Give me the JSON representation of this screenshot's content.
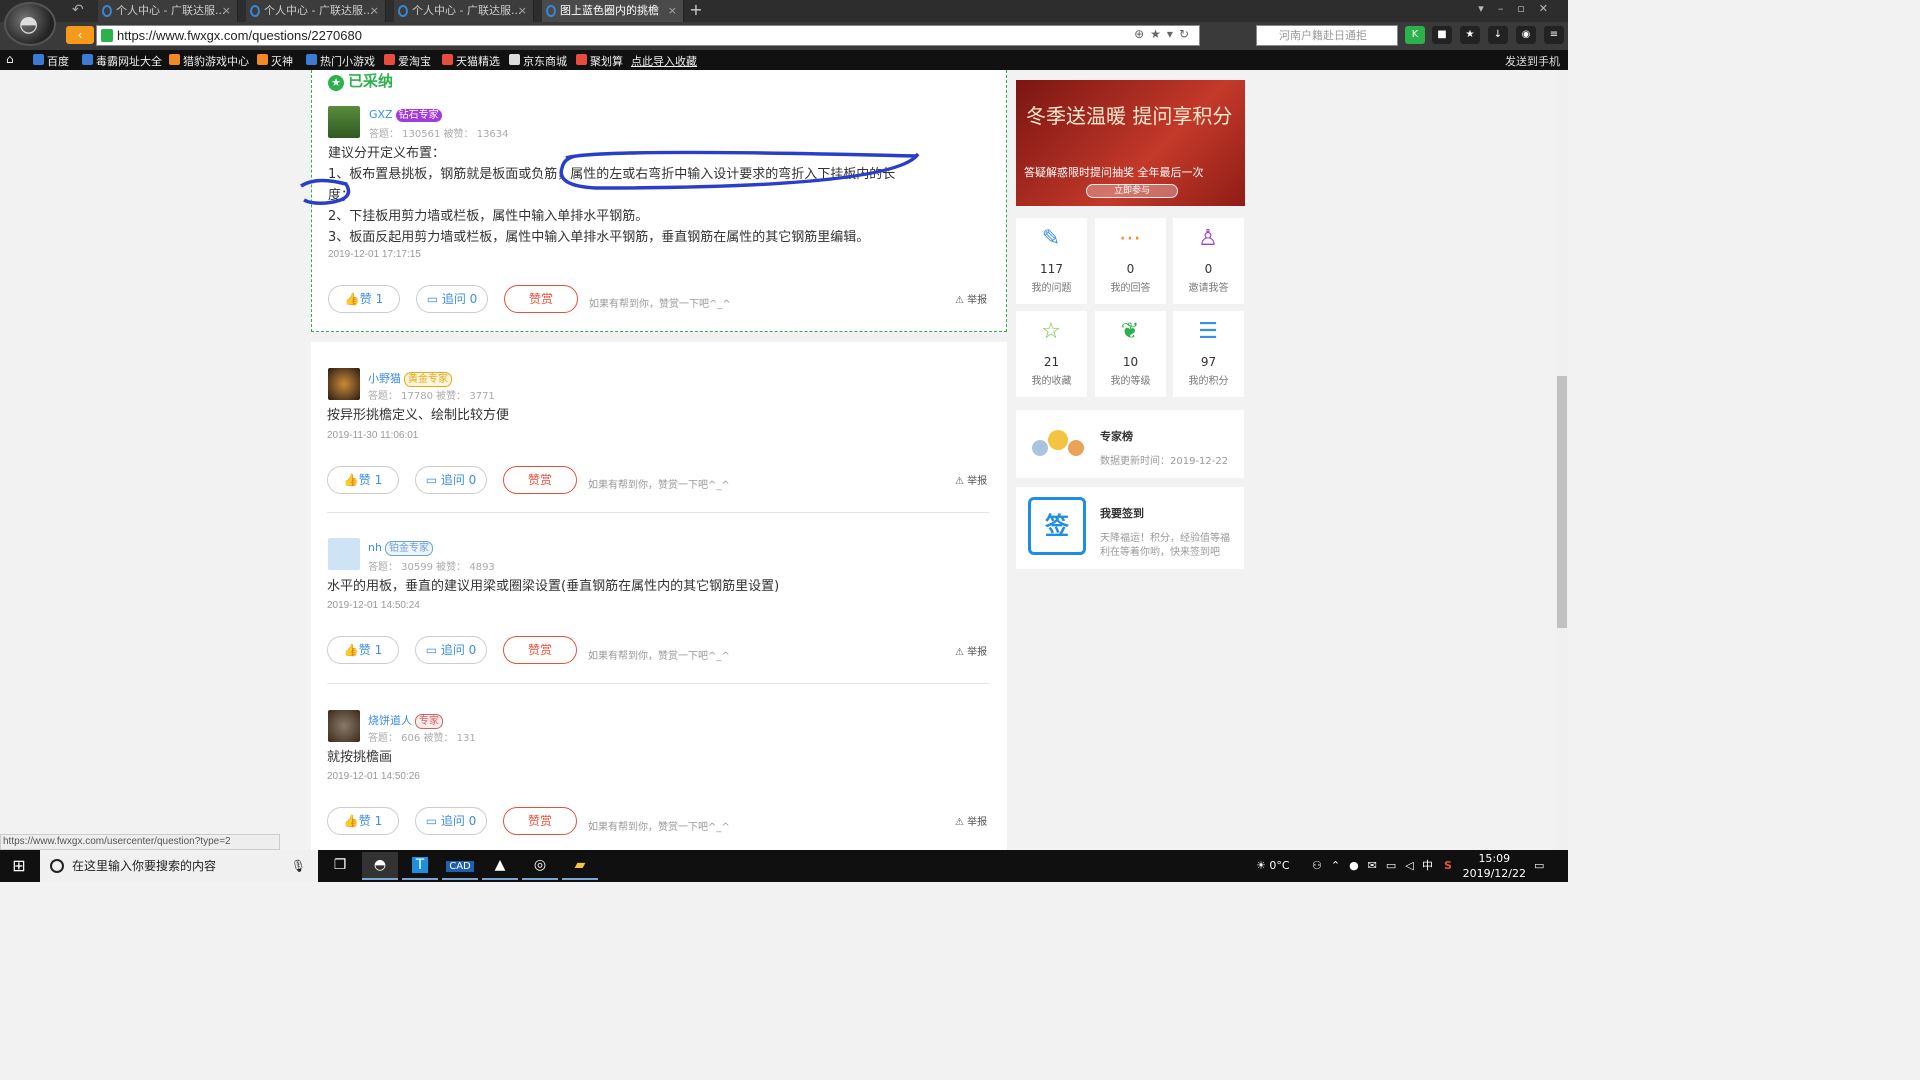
{
  "browser": {
    "tabs": [
      {
        "label": "个人中心 - 广联达服..."
      },
      {
        "label": "个人中心 - 广联达服..."
      },
      {
        "label": "个人中心 - 广联达服..."
      },
      {
        "label": "图上蓝色圈内的挑檐"
      }
    ],
    "url": "https://www.fwxgx.com/questions/2270680",
    "search_placeholder": "河南户籍赴日通拒",
    "bookmarks": [
      "百度",
      "毒霸网址大全",
      "猎豹游戏中心",
      "灭神",
      "热门小游戏",
      "爱淘宝",
      "天猫精选",
      "京东商城",
      "聚划算",
      "点此导入收藏"
    ],
    "send_to_phone": "发送到手机",
    "status_url": "https://www.fwxgx.com/usercenter/question?type=2"
  },
  "accepted_label": "已采纳",
  "answers": [
    {
      "user": "GXZ",
      "badge": "钻石专家",
      "badge_color": "#a33bd8",
      "stats": "答题：  130561    被赞：  13634",
      "lines": [
        "建议分开定义布置：",
        "1、板布置悬挑板，钢筋就是板面或负筋，属性的左或右弯折中输入设计要求的弯折入下挂板内的长",
        "度；",
        "2、下挂板用剪力墙或栏板，属性中输入单排水平钢筋。",
        "3、板面反起用剪力墙或栏板，属性中输入单排水平钢筋，垂直钢筋在属性的其它钢筋里编辑。"
      ],
      "date": "2019-12-01 17:17:15",
      "likes": "赞 1",
      "followups": "追问  0",
      "reward": "赞赏",
      "hint": "如果有帮到你，赞赏一下吧^_^",
      "report": "举报"
    },
    {
      "user": "小野猫",
      "badge": "黄金专家",
      "badge_color": "#e6a817",
      "stats": "答题：  17780    被赞：  3771",
      "lines": [
        "按异形挑檐定义、绘制比较方便"
      ],
      "date": "2019-11-30 11:06:01",
      "likes": "赞 1",
      "followups": "追问  0",
      "reward": "赞赏",
      "hint": "如果有帮到你，赞赏一下吧^_^",
      "report": "举报"
    },
    {
      "user": "nh",
      "badge": "铂金专家",
      "badge_color": "#6f9fd4",
      "stats": "答题：  30599    被赞：  4893",
      "lines": [
        "水平的用板，垂直的建议用梁或圈梁设置(垂直钢筋在属性内的其它钢筋里设置)"
      ],
      "date": "2019-12-01 14:50:24",
      "likes": "赞 1",
      "followups": "追问  0",
      "reward": "赞赏",
      "hint": "如果有帮到你，赞赏一下吧^_^",
      "report": "举报"
    },
    {
      "user": "烧饼道人",
      "badge": "专家",
      "badge_color": "#d45f5f",
      "stats": "答题：  606    被赞：  131",
      "lines": [
        "就按挑檐画"
      ],
      "date": "2019-12-01 14:50:26",
      "likes": "赞 1",
      "followups": "追问  0",
      "reward": "赞赏",
      "hint": "如果有帮到你，赞赏一下吧^_^",
      "report": "举报"
    }
  ],
  "sidebar": {
    "banner_title": "冬季送温暖 提问享积分",
    "banner_sub": "答疑解惑限时提问抽奖  全年最后一次",
    "banner_btn": "立即参与",
    "stats": [
      {
        "value": "117",
        "label": "我的问题",
        "icon": "edit-icon",
        "color": "#3a8ee6"
      },
      {
        "value": "0",
        "label": "我的回答",
        "icon": "chat-icon",
        "color": "#f08a24"
      },
      {
        "value": "0",
        "label": "邀请我答",
        "icon": "user-add-icon",
        "color": "#a33bd8"
      },
      {
        "value": "21",
        "label": "我的收藏",
        "icon": "star-icon",
        "color": "#6cc644"
      },
      {
        "value": "10",
        "label": "我的等级",
        "icon": "leaf-icon",
        "color": "#2bb24c"
      },
      {
        "value": "97",
        "label": "我的积分",
        "icon": "coins-icon",
        "color": "#3a8ee6"
      }
    ],
    "rank_title": "专家榜",
    "rank_update": "数据更新时间：2019-12-22",
    "sign_title": "我要签到",
    "sign_icon_text": "签",
    "sign_desc_1": "天降福运！积分，经验值等福",
    "sign_desc_2": "利在等着你哟，快来签到吧"
  },
  "taskbar": {
    "search_placeholder": "在这里输入你要搜索的内容",
    "temperature": "0°C",
    "ime": "中",
    "time": "15:09",
    "date": "2019/12/22"
  }
}
